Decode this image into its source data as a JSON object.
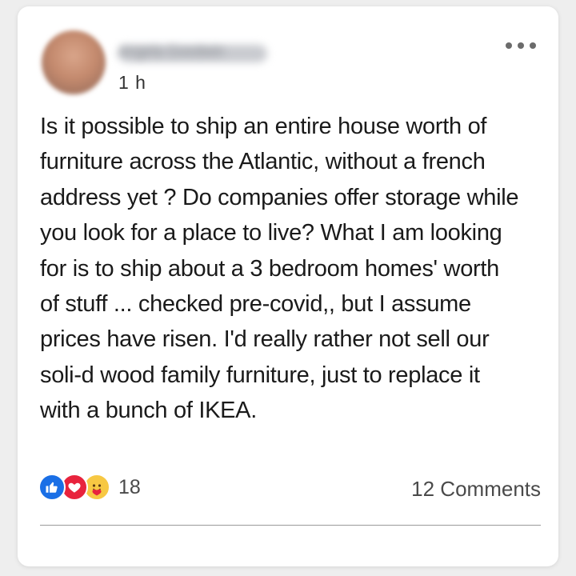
{
  "post": {
    "author_name": "Angela Goodwin",
    "timestamp": "1 h",
    "text": "Is it possible to ship an entire house worth of furniture across the Atlantic, without a french address yet ? Do companies offer storage while you look for a place to live? What I am looking for is to ship about a 3 bedroom homes' worth of stuff ... checked pre-covid,, but I assume prices have risen. I'd really rather not sell our soli-d wood family furniture, just to replace it with a bunch of IKEA."
  },
  "reactions": {
    "icons": [
      "like-icon",
      "love-icon",
      "care-icon"
    ],
    "count": "18",
    "colors": {
      "like": "#1a6fe6",
      "love": "#e8233d",
      "care": "#f7c843"
    }
  },
  "comments": {
    "label": "12 Comments"
  },
  "menu": {
    "icon": "more-options-icon"
  }
}
